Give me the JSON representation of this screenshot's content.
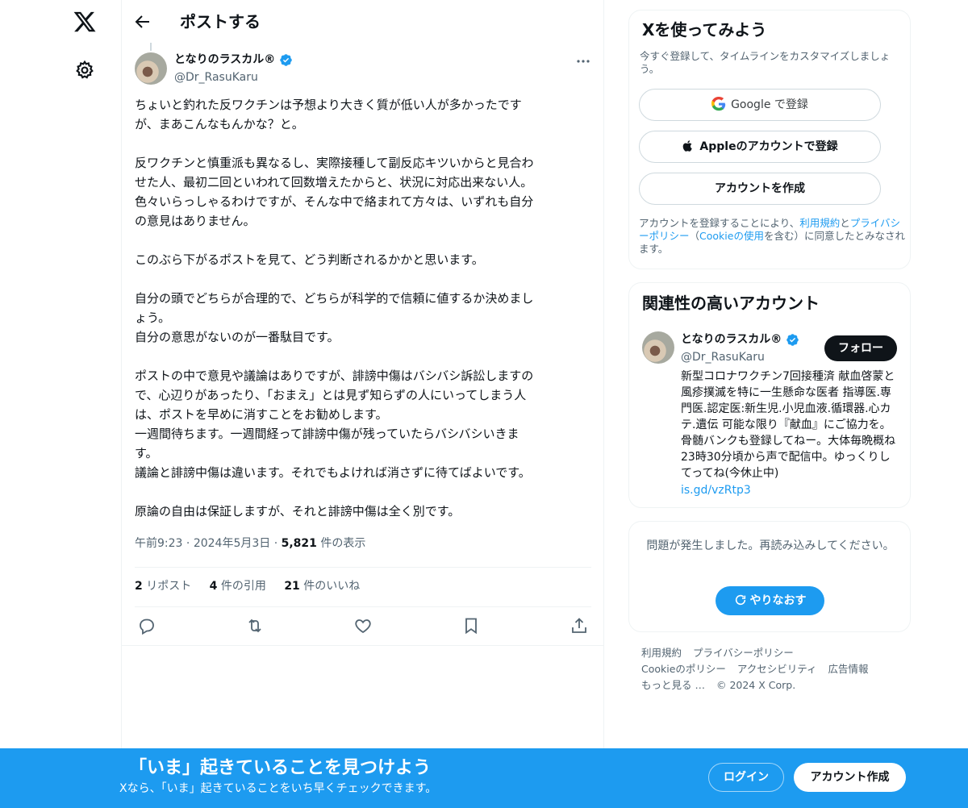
{
  "header": {
    "title": "ポストする"
  },
  "post": {
    "author_name": "となりのラスカル®",
    "author_handle": "@Dr_RasuKaru",
    "paragraphs": [
      [
        "ちょいと釣れた反ワクチンは予想より大きく質が低い人が多かったです",
        "が、まあこんなもんかな？と。"
      ],
      [
        "反ワクチンと慎重派も異なるし、実際接種して副反応キツいからと見合わ",
        "せた人、最初二回といわれて回数増えたからと、状況に対応出来ない人。",
        "色々いらっしゃるわけですが、そんな中で絡まれて方々は、いずれも自分",
        "の意見はありません。"
      ],
      [
        "このぶら下がるポストを見て、どう判断されるかかと思います。"
      ],
      [
        "自分の頭でどちらが合理的で、どちらが科学的で信頼に値するか決めまし",
        "ょう。",
        "自分の意思がないのが一番駄目です。"
      ],
      [
        "ポストの中で意見や議論はありですが、誹謗中傷はバシバシ訴訟しますの",
        "で、心辺りがあったり、「おまえ」とは見ず知らずの人にいってしまう人",
        "は、ポストを早めに消すことをお勧めします。",
        "一週間待ちます。一週間経って誹謗中傷が残っていたらバシバシいきま",
        "す。",
        "議論と誹謗中傷は違います。それでもよければ消さずに待てばよいです。"
      ],
      [
        "原論の自由は保証しますが、それと誹謗中傷は全く別です。"
      ]
    ],
    "time": "午前9:23",
    "date": "2024年5月3日",
    "dot": "·",
    "views_count": "5,821",
    "views_label": "件の表示",
    "reposts_count": "2",
    "reposts_label": "リポスト",
    "quotes_count": "4",
    "quotes_label": "件の引用",
    "likes_count": "21",
    "likes_label": "件のいいね"
  },
  "signup_card": {
    "title": "Xを使ってみよう",
    "subtitle": "今すぐ登録して、タイムラインをカスタマイズしましょう。",
    "google_brand": "Google",
    "google_suffix": " で登録",
    "apple_label": "Appleのアカウントで登録",
    "create_label": "アカウントを作成",
    "legal_1": "アカウントを登録することにより、",
    "legal_terms": "利用規約",
    "legal_and": "と",
    "legal_privacy": "プライバシーポリシー",
    "legal_2": "（",
    "legal_cookie": "Cookieの使用",
    "legal_3": "を含む）に同意したとみなされます。"
  },
  "relevant_card": {
    "title": "関連性の高いアカウント",
    "name": "となりのラスカル®",
    "handle": "@Dr_RasuKaru",
    "follow_label": "フォロー",
    "bio": "新型コロナワクチン7回接種済 献血啓蒙と風疹撲滅を特に一生懸命な医者 指導医.専門医.認定医:新生児.小児血液.循環器.心カテ.遺伝 可能な限り『献血』にご協力を。骨髄バンクも登録してねー。大体毎晩概ね23時30分頃から声で配信中。ゆっくりしてってね(今休止中)",
    "link": "is.gd/vzRtp3"
  },
  "error_card": {
    "message": "問題が発生しました。再読み込みしてください。",
    "retry_label": "やりなおす"
  },
  "footer": {
    "links": [
      "利用規約",
      "プライバシーポリシー",
      "Cookieのポリシー",
      "アクセシビリティ",
      "広告情報",
      "もっと見る …"
    ],
    "copyright": "© 2024 X Corp."
  },
  "banner": {
    "title": "「いま」起きていることを見つけよう",
    "subtitle": "Xなら、「いま」起きていることをいち早くチェックできます。",
    "login_label": "ログイン",
    "signup_label": "アカウント作成"
  },
  "colors": {
    "accent": "#1d9bf0",
    "text": "#0f1419",
    "muted": "#536471",
    "border": "#eff3f4"
  },
  "icons": [
    "x-logo-icon",
    "gear-icon",
    "back-arrow-icon",
    "verified-badge-icon",
    "more-icon",
    "reply-icon",
    "repost-icon",
    "like-icon",
    "bookmark-icon",
    "share-icon",
    "google-icon",
    "apple-icon",
    "refresh-icon"
  ]
}
